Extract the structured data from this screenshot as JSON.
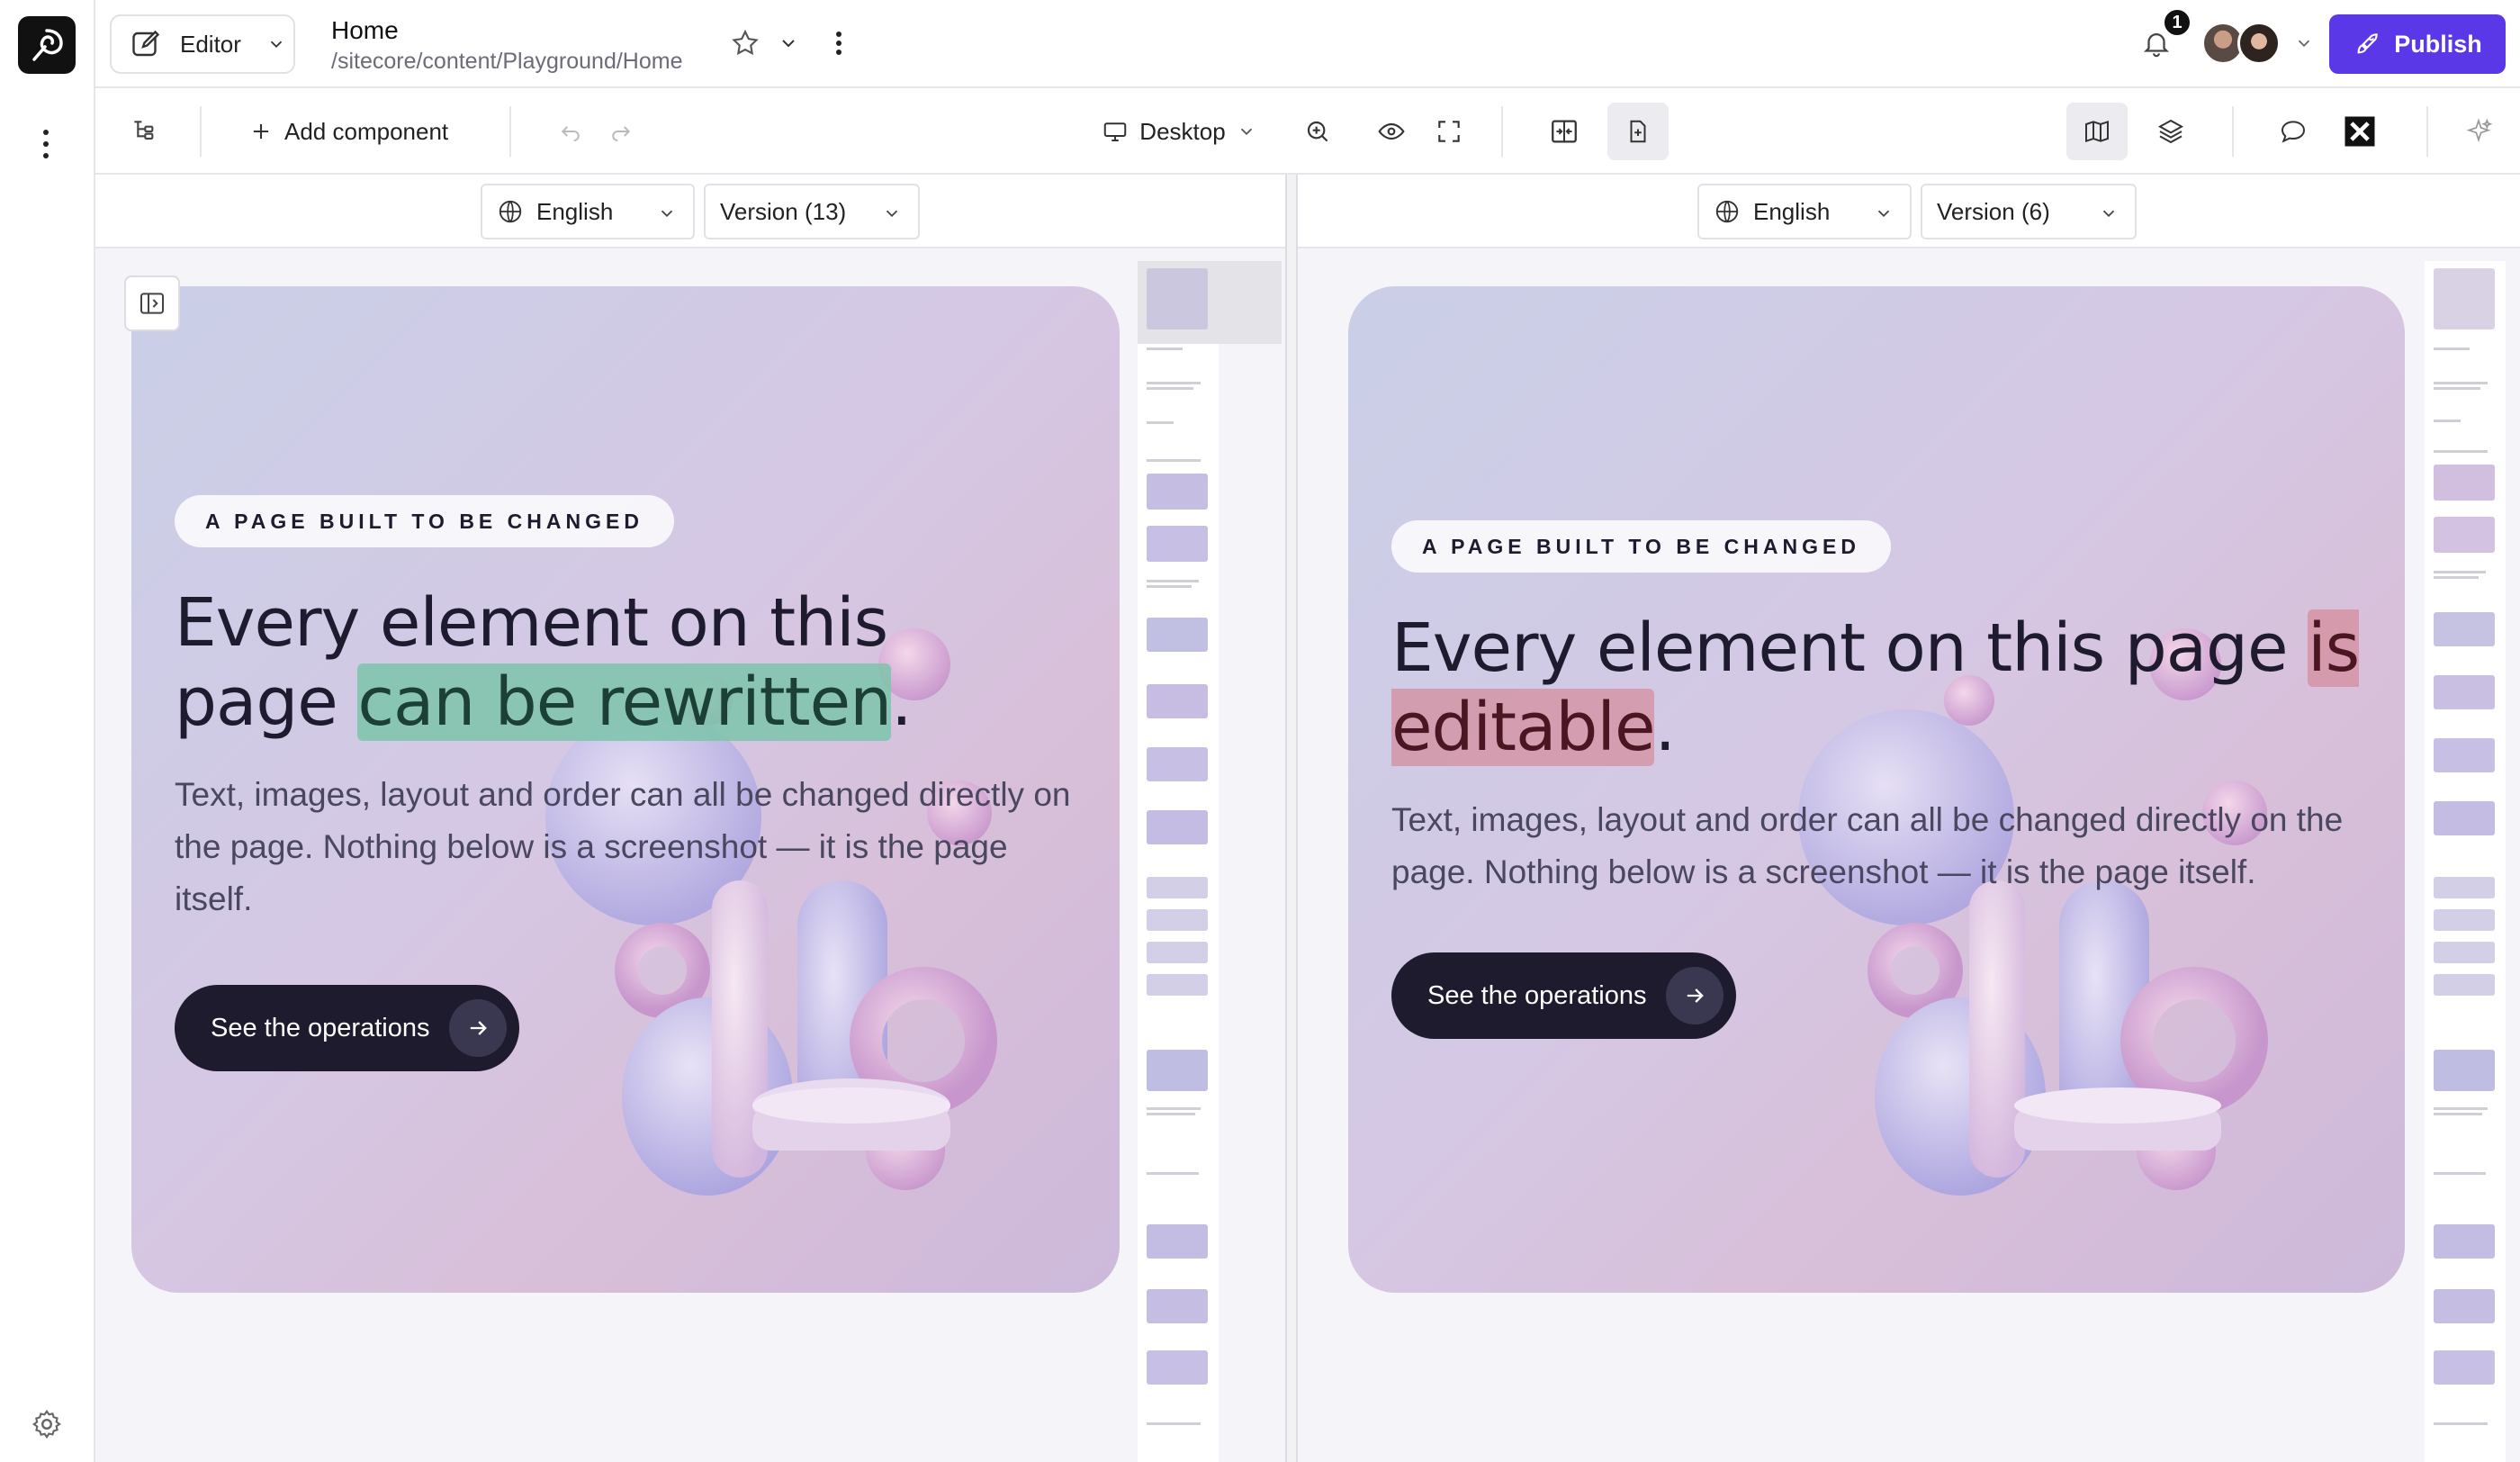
{
  "header": {
    "mode_label": "Editor",
    "page_title": "Home",
    "page_path": "/sitecore/content/Playground/Home",
    "notification_count": "1",
    "publish_label": "Publish"
  },
  "toolbar": {
    "add_component_label": "Add component",
    "device_label": "Desktop"
  },
  "left_pane": {
    "language": "English",
    "version": "Version (13)",
    "eyebrow": "A PAGE BUILT TO BE CHANGED",
    "headline_before": "Every element on this page ",
    "headline_highlight": "can be rewritten",
    "headline_after": ".",
    "body": "Text, images, layout and order can all be changed directly on the page. Nothing below is a screenshot — it is the page itself.",
    "cta_label": "See the operations",
    "highlight_color": "#7cc4aa"
  },
  "right_pane": {
    "language": "English",
    "version": "Version (6)",
    "eyebrow": "A PAGE BUILT TO BE CHANGED",
    "headline_before": "Every element on this page ",
    "headline_highlight": "is editable",
    "headline_after": ".",
    "body": "Text, images, layout and order can all be changed directly on the page. Nothing below is a screenshot — it is the page itself.",
    "cta_label": "See the operations",
    "highlight_color": "#d48e9e"
  },
  "colors": {
    "accent": "#5a38e8",
    "dark": "#1e1b2e"
  }
}
